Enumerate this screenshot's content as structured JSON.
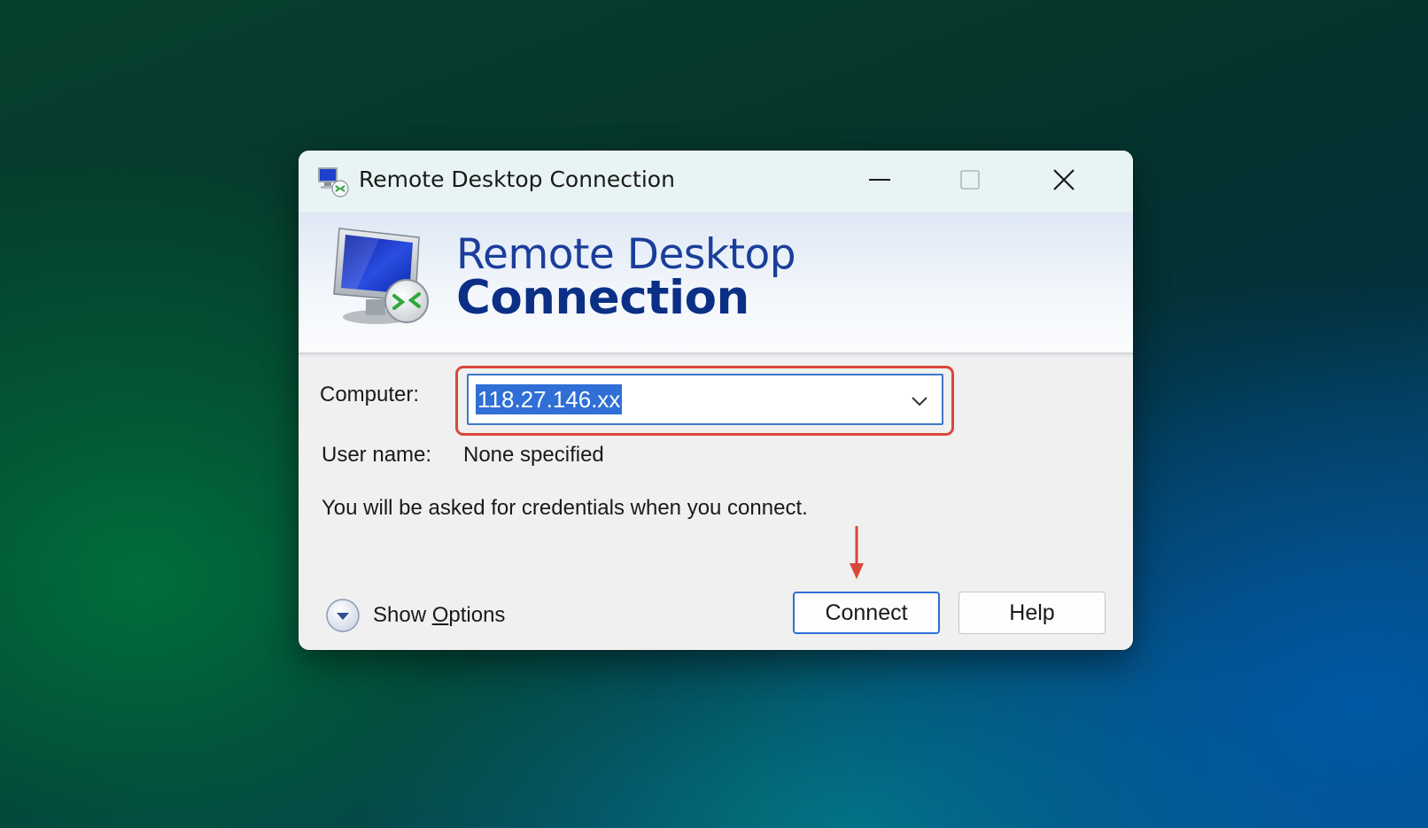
{
  "window": {
    "title": "Remote Desktop Connection"
  },
  "banner": {
    "line1": "Remote Desktop",
    "line2": "Connection"
  },
  "form": {
    "computer_label": "Computer:",
    "computer_value": "118.27.146.xx",
    "username_label": "User name:",
    "username_value": "None specified",
    "info_text": "You will be asked for credentials when you connect."
  },
  "footer": {
    "show_options_prefix": "Show ",
    "show_options_underlined": "O",
    "show_options_suffix": "ptions",
    "connect_label": "Connect",
    "help_label": "Help"
  },
  "icons": {
    "app": "remote-desktop-app-icon",
    "banner": "remote-desktop-monitor-icon",
    "minimize": "minimize-icon",
    "maximize": "maximize-icon",
    "close": "close-icon",
    "dropdown": "chevron-down-icon",
    "options": "expand-circle-icon",
    "annotation": "red-arrow-down-icon"
  },
  "colors": {
    "highlight": "#d9473a",
    "accent": "#2f6fd6",
    "banner_title": "#1a3e9a",
    "titlebar": "#e8f4f3"
  }
}
